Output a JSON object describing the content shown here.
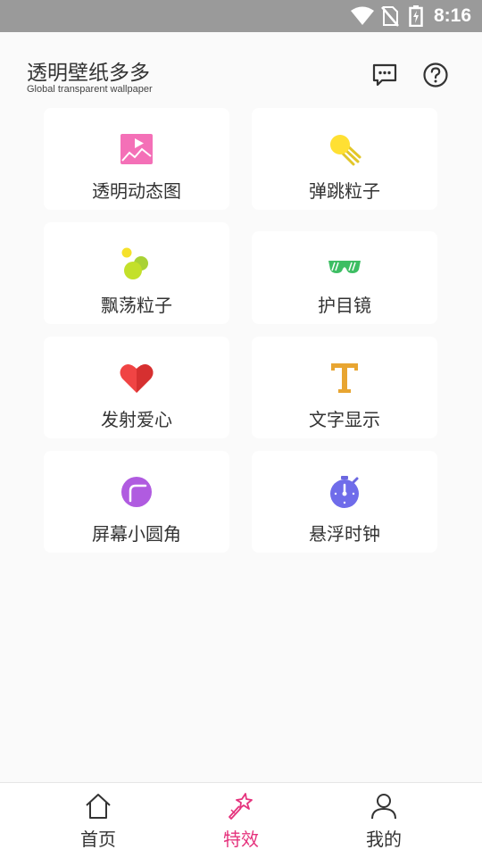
{
  "status_bar": {
    "time": "8:16",
    "icons": [
      "wifi-icon",
      "no-sim-icon",
      "battery-icon"
    ]
  },
  "header": {
    "title": "透明壁纸多多",
    "subtitle": "Global transparent wallpaper",
    "icons": [
      "message-icon",
      "help-icon"
    ]
  },
  "features": [
    {
      "label": "透明动态图",
      "icon": "dynamic-image-icon"
    },
    {
      "label": "弹跳粒子",
      "icon": "bouncing-ball-icon"
    },
    {
      "label": "飘荡粒子",
      "icon": "floating-particles-icon"
    },
    {
      "label": "护目镜",
      "icon": "goggles-icon"
    },
    {
      "label": "发射爱心",
      "icon": "heart-icon"
    },
    {
      "label": "文字显示",
      "icon": "text-t-icon"
    },
    {
      "label": "屏幕小圆角",
      "icon": "rounded-corner-icon"
    },
    {
      "label": "悬浮时钟",
      "icon": "stopwatch-icon"
    }
  ],
  "bottom_nav": {
    "active": 1,
    "items": [
      {
        "label": "首页",
        "icon": "home-icon"
      },
      {
        "label": "特效",
        "icon": "magic-wand-icon"
      },
      {
        "label": "我的",
        "icon": "user-icon"
      }
    ]
  },
  "colors": {
    "accent": "#e5337d",
    "status_bar": "#9a9a9a",
    "background": "#fafafa"
  }
}
